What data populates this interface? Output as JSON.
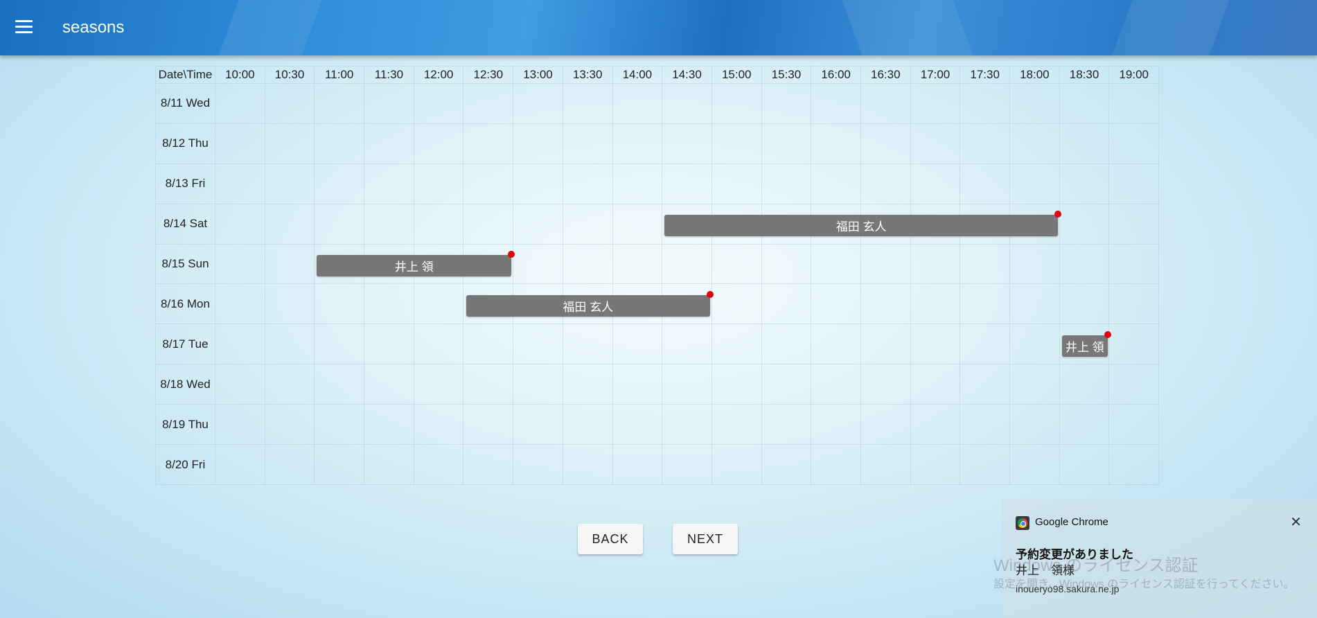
{
  "app_title": "seasons",
  "grid": {
    "corner": "Date\\Time",
    "times": [
      "10:00",
      "10:30",
      "11:00",
      "11:30",
      "12:00",
      "12:30",
      "13:00",
      "13:30",
      "14:00",
      "14:30",
      "15:00",
      "15:30",
      "16:00",
      "16:30",
      "17:00",
      "17:30",
      "18:00",
      "18:30",
      "19:00"
    ],
    "dates": [
      "8/11 Wed",
      "8/12 Thu",
      "8/13 Fri",
      "8/14 Sat",
      "8/15 Sun",
      "8/16 Mon",
      "8/17 Tue",
      "8/18 Wed",
      "8/19 Thu",
      "8/20 Fri"
    ]
  },
  "bookings": [
    {
      "name": "福田 玄人",
      "date": "8/14 Sat",
      "start": "14:30",
      "end": "18:30"
    },
    {
      "name": "井上 領",
      "date": "8/15 Sun",
      "start": "11:00",
      "end": "13:00"
    },
    {
      "name": "福田 玄人",
      "date": "8/16 Mon",
      "start": "12:30",
      "end": "15:00"
    },
    {
      "name": "井上 領",
      "date": "8/17 Tue",
      "start": "18:30",
      "end": "19:00"
    }
  ],
  "buttons": {
    "back": "BACK",
    "next": "NEXT"
  },
  "notification": {
    "app": "Google Chrome",
    "title": "予約変更がありました",
    "body": "井上　領様",
    "source": "inoueryo98.sakura.ne.jp",
    "close_icon": "close-icon"
  },
  "watermark": {
    "line1": "Windows のライセンス認証",
    "line2": "設定を開き、Windows のライセンス認証を行ってください。"
  },
  "colors": {
    "appbar": "#2d8ad6",
    "booking": "#777777",
    "marker": "#e3000f"
  }
}
